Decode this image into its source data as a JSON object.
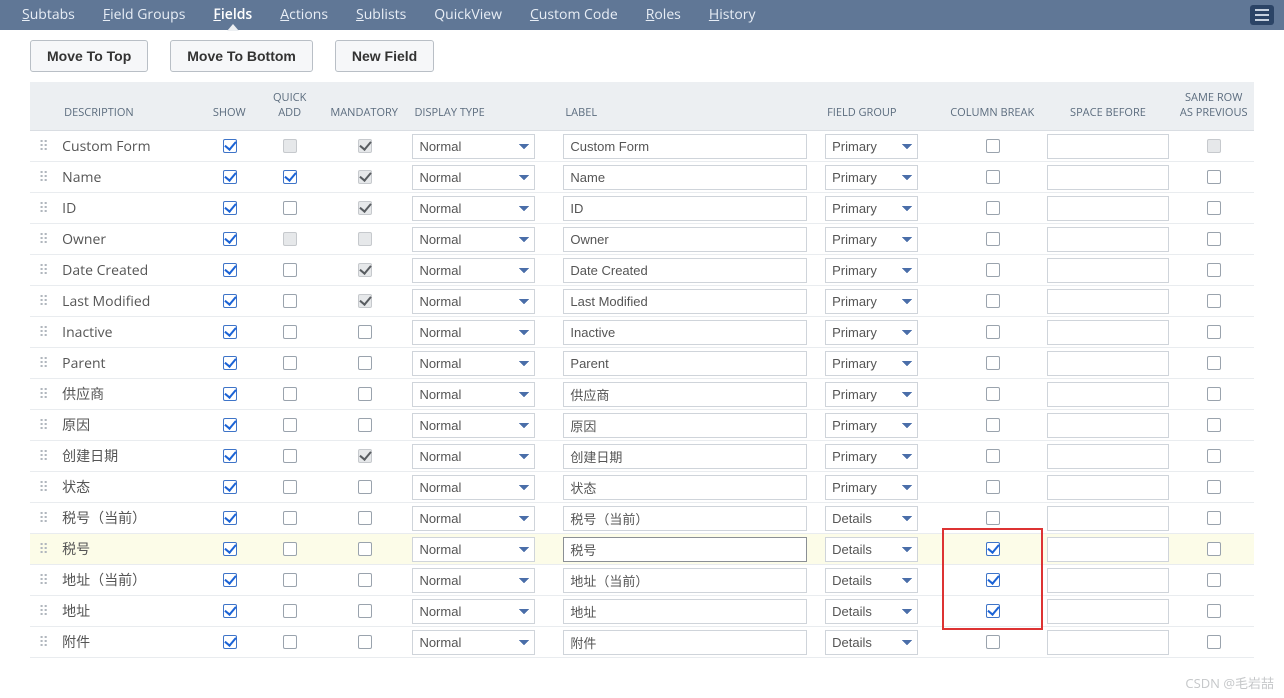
{
  "tabs": [
    {
      "label": "Subtabs",
      "u": "S"
    },
    {
      "label": "Field Groups",
      "u": "F"
    },
    {
      "label": "Fields",
      "u": "F",
      "active": true
    },
    {
      "label": "Actions",
      "u": "A"
    },
    {
      "label": "Sublists",
      "u": "S"
    },
    {
      "label": "QuickView"
    },
    {
      "label": "Custom Code",
      "u": "C"
    },
    {
      "label": "Roles",
      "u": "R"
    },
    {
      "label": "History",
      "u": "H"
    }
  ],
  "buttons": {
    "move_top": "Move To Top",
    "move_bottom": "Move To Bottom",
    "new_field": "New Field"
  },
  "columns": {
    "description": "DESCRIPTION",
    "show": "SHOW",
    "quick_add": "QUICK ADD",
    "mandatory": "MANDATORY",
    "display_type": "DISPLAY TYPE",
    "label": "LABEL",
    "field_group": "FIELD GROUP",
    "column_break": "COLUMN BREAK",
    "space_before": "SPACE BEFORE",
    "same_row": "SAME ROW AS PREVIOUS"
  },
  "display_type_options": [
    "Normal"
  ],
  "field_group_options": [
    "Primary",
    "Details"
  ],
  "rows": [
    {
      "desc": "Custom Form",
      "show": true,
      "qa": null,
      "qa_disabled": true,
      "mand": true,
      "mand_disabled": true,
      "dt": "Normal",
      "label": "Custom Form",
      "fg": "Primary",
      "cb": false,
      "sb": "",
      "sr": null,
      "sr_disabled": true
    },
    {
      "desc": "Name",
      "show": true,
      "qa": true,
      "mand": true,
      "mand_disabled": true,
      "dt": "Normal",
      "label": "Name",
      "fg": "Primary",
      "cb": false,
      "sb": "",
      "sr": false
    },
    {
      "desc": "ID",
      "show": true,
      "qa": false,
      "mand": true,
      "mand_disabled": true,
      "dt": "Normal",
      "label": "ID",
      "fg": "Primary",
      "cb": false,
      "sb": "",
      "sr": false
    },
    {
      "desc": "Owner",
      "show": true,
      "qa": null,
      "qa_disabled": true,
      "mand": false,
      "mand_disabled": true,
      "dt": "Normal",
      "label": "Owner",
      "fg": "Primary",
      "cb": false,
      "sb": "",
      "sr": false
    },
    {
      "desc": "Date Created",
      "show": true,
      "qa": false,
      "mand": true,
      "mand_disabled": true,
      "dt": "Normal",
      "label": "Date Created",
      "fg": "Primary",
      "cb": false,
      "sb": "",
      "sr": false
    },
    {
      "desc": "Last Modified",
      "show": true,
      "qa": false,
      "mand": true,
      "mand_disabled": true,
      "dt": "Normal",
      "label": "Last Modified",
      "fg": "Primary",
      "cb": false,
      "sb": "",
      "sr": false
    },
    {
      "desc": "Inactive",
      "show": true,
      "qa": false,
      "mand": false,
      "dt": "Normal",
      "label": "Inactive",
      "fg": "Primary",
      "cb": false,
      "sb": "",
      "sr": false
    },
    {
      "desc": "Parent",
      "show": true,
      "qa": false,
      "mand": false,
      "dt": "Normal",
      "label": "Parent",
      "fg": "Primary",
      "cb": false,
      "sb": "",
      "sr": false
    },
    {
      "desc": "供应商",
      "show": true,
      "qa": false,
      "mand": false,
      "dt": "Normal",
      "label": "供应商",
      "fg": "Primary",
      "cb": false,
      "sb": "",
      "sr": false
    },
    {
      "desc": "原因",
      "show": true,
      "qa": false,
      "mand": false,
      "dt": "Normal",
      "label": "原因",
      "fg": "Primary",
      "cb": false,
      "sb": "",
      "sr": false
    },
    {
      "desc": "创建日期",
      "show": true,
      "qa": false,
      "mand": true,
      "mand_disabled": true,
      "dt": "Normal",
      "label": "创建日期",
      "fg": "Primary",
      "cb": false,
      "sb": "",
      "sr": false
    },
    {
      "desc": "状态",
      "show": true,
      "qa": false,
      "mand": false,
      "dt": "Normal",
      "label": "状态",
      "fg": "Primary",
      "cb": false,
      "sb": "",
      "sr": false
    },
    {
      "desc": "税号（当前）",
      "show": true,
      "qa": false,
      "mand": false,
      "dt": "Normal",
      "label": "税号（当前）",
      "fg": "Details",
      "cb": false,
      "sb": "",
      "sr": false
    },
    {
      "desc": "税号",
      "show": true,
      "qa": false,
      "mand": false,
      "dt": "Normal",
      "label": "税号",
      "fg": "Details",
      "cb": true,
      "sb": "",
      "sr": false,
      "selected": true,
      "label_active": true,
      "highlight": "top"
    },
    {
      "desc": "地址（当前）",
      "show": true,
      "qa": false,
      "mand": false,
      "dt": "Normal",
      "label": "地址（当前）",
      "fg": "Details",
      "cb": true,
      "sb": "",
      "sr": false,
      "highlight": "mid"
    },
    {
      "desc": "地址",
      "show": true,
      "qa": false,
      "mand": false,
      "dt": "Normal",
      "label": "地址",
      "fg": "Details",
      "cb": true,
      "sb": "",
      "sr": false,
      "highlight": "bot"
    },
    {
      "desc": "附件",
      "show": true,
      "qa": false,
      "mand": false,
      "dt": "Normal",
      "label": "附件",
      "fg": "Details",
      "cb": false,
      "sb": "",
      "sr": false
    }
  ],
  "watermark": "CSDN @毛岩喆"
}
